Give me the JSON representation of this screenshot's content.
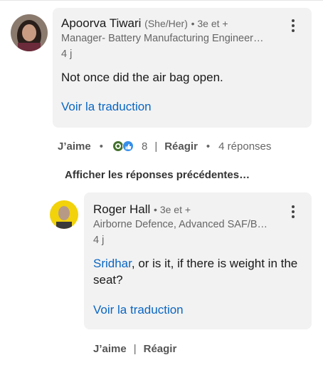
{
  "comment1": {
    "author_name": "Apoorva Tiwari",
    "pronouns": "(She/Her)",
    "connection": "• 3e et +",
    "headline": "Manager- Battery Manufacturing Engineer…",
    "time": "4 j",
    "text": "Not once did the air bag open.",
    "translate_label": "Voir la traduction",
    "actions": {
      "like": "J’aime",
      "reaction_count": "8",
      "react": "Réagir",
      "replies": "4 réponses"
    }
  },
  "previous_replies_label": "Afficher les réponses précédentes…",
  "reply1": {
    "author_name": "Roger Hall",
    "connection": "• 3e et +",
    "headline": "Airborne Defence, Advanced SAF/B…",
    "time": "4 j",
    "mention": "Sridhar",
    "text_rest": ", or is it, if there is weight in the seat?",
    "translate_label": "Voir la traduction",
    "actions": {
      "like": "J’aime",
      "react": "Réagir"
    }
  },
  "icons": [
    "more-options-icon",
    "celebrate-reaction-icon",
    "like-reaction-icon"
  ],
  "colors": {
    "link": "#0a66c2",
    "bubble": "#f2f2f2",
    "secondary_text": "#666666"
  }
}
